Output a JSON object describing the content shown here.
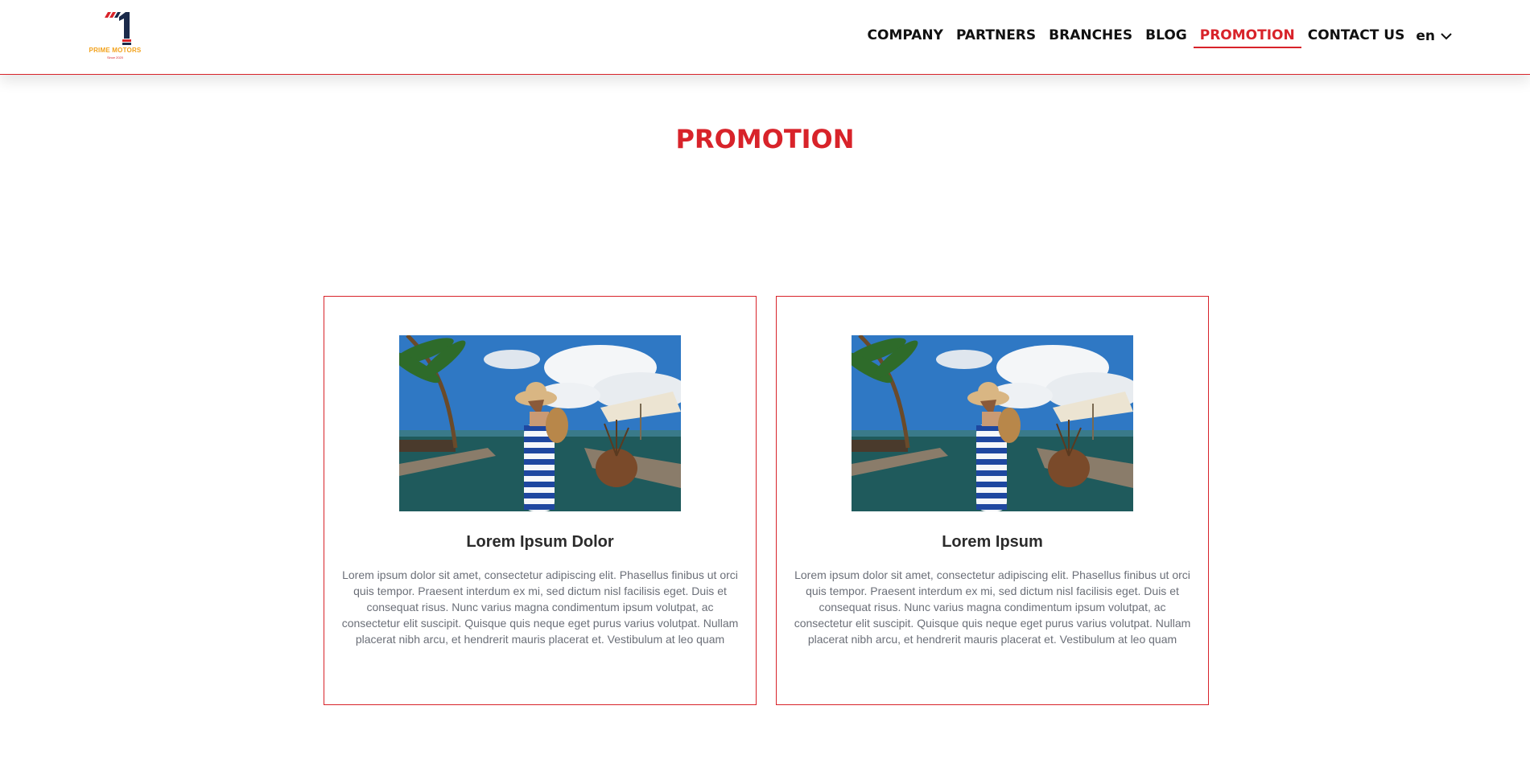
{
  "header": {
    "logo": {
      "brand": "PRIME MOTORS",
      "since": "Since 2020",
      "icon": "prime-motors-logo"
    },
    "nav": [
      {
        "label": "COMPANY"
      },
      {
        "label": "PARTNERS"
      },
      {
        "label": "BRANCHES"
      },
      {
        "label": "BLOG"
      },
      {
        "label": "PROMOTION",
        "active": true
      },
      {
        "label": "CONTACT US"
      }
    ],
    "language": {
      "value": "en",
      "icon": "chevron-down-icon"
    }
  },
  "page": {
    "title": "PROMOTION"
  },
  "promotions": [
    {
      "title": "Lorem Ipsum Dolor",
      "text": "Lorem ipsum dolor sit amet, consectetur adipiscing elit. Phasellus finibus ut orci quis tempor. Praesent interdum ex mi, sed dictum nisl facilisis eget. Duis et consequat risus. Nunc varius magna condimentum ipsum volutpat, ac consectetur elit suscipit. Quisque quis neque eget purus varius volutpat. Nullam placerat nibh arcu, et hendrerit mauris placerat et. Vestibulum at leo quam",
      "image": "woman-at-resort-pool"
    },
    {
      "title": "Lorem Ipsum",
      "text": "Lorem ipsum dolor sit amet, consectetur adipiscing elit. Phasellus finibus ut orci quis tempor. Praesent interdum ex mi, sed dictum nisl facilisis eget. Duis et consequat risus. Nunc varius magna condimentum ipsum volutpat, ac consectetur elit suscipit. Quisque quis neque eget purus varius volutpat. Nullam placerat nibh arcu, et hendrerit mauris placerat et. Vestibulum at leo quam",
      "image": "woman-at-resort-pool"
    }
  ],
  "colors": {
    "accent": "#d8232a",
    "logo_navy": "#1b2a4a",
    "logo_gold": "#f2a21c"
  }
}
